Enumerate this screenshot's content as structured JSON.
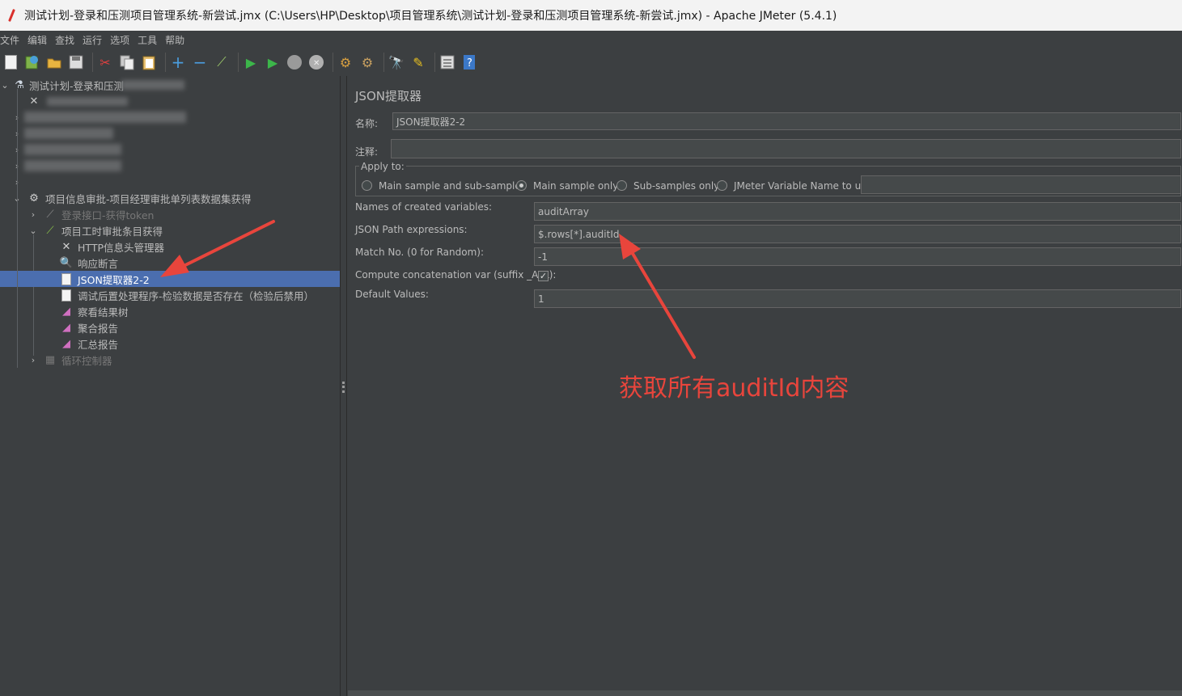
{
  "window": {
    "title": "测试计划-登录和压测项目管理系统-新尝试.jmx (C:\\Users\\HP\\Desktop\\项目管理系统\\测试计划-登录和压测项目管理系统-新尝试.jmx) - Apache JMeter (5.4.1)"
  },
  "menu": [
    "文件",
    "编辑",
    "查找",
    "运行",
    "选项",
    "工具",
    "帮助"
  ],
  "toolbar": [
    "new-icon",
    "templates-icon",
    "open-icon",
    "save-icon",
    "cut-icon",
    "copy-icon",
    "paste-icon",
    "expand-icon",
    "collapse-icon",
    "toggle-icon",
    "start-icon",
    "start-no-pause-icon",
    "stop-icon",
    "shutdown-icon",
    "clear-icon",
    "clear-all-icon",
    "search-icon",
    "reset-search-icon",
    "function-helper-icon",
    "help-icon"
  ],
  "tree": {
    "root": "测试计划-登录和压测",
    "thread_group": "项目信息审批-项目经理审批单列表数据集获得",
    "login_sampler": "登录接口-获得token",
    "sampler": "项目工时审批条目获得",
    "header_manager": "HTTP信息头管理器",
    "assertion": "响应断言",
    "json_extractor": "JSON提取器2-2",
    "debug_postprocessor": "调试后置处理程序-检验数据是否存在（检验后禁用）",
    "view_results": "察看结果树",
    "aggregate_report": "聚合报告",
    "summary_report": "汇总报告",
    "loop_controller": "循环控制器"
  },
  "panel": {
    "title": "JSON提取器",
    "name_label": "名称:",
    "name_value": "JSON提取器2-2",
    "comment_label": "注释:",
    "comment_value": "",
    "apply_to_label": "Apply to:",
    "apply_options": [
      "Main sample and sub-samples",
      "Main sample only",
      "Sub-samples only",
      "JMeter Variable Name to use"
    ],
    "apply_selected": "Main sample only",
    "variables_label": "Names of created variables:",
    "variables_value": "auditArray",
    "json_path_label": "JSON Path expressions:",
    "json_path_value": "$.rows[*].auditId",
    "match_no_label": "Match No. (0 for Random):",
    "match_no_value": "-1",
    "concat_label": "Compute concatenation var (suffix _ALL):",
    "concat_checked": true,
    "default_label": "Default Values:",
    "default_value": "1"
  },
  "annotation": {
    "text": "获取所有auditId内容",
    "color": "#e8453c"
  }
}
